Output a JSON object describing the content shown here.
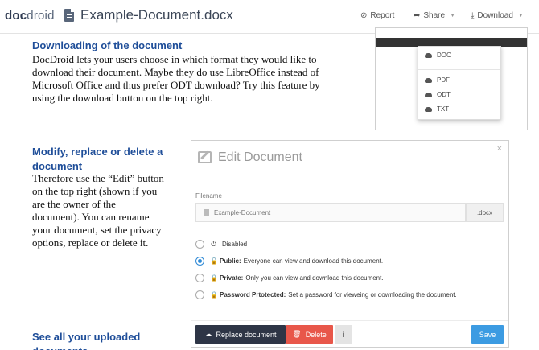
{
  "header": {
    "brand_bold": "doc",
    "brand_rest": "droid",
    "document_title": "Example-Document.docx",
    "report_label": "Report",
    "share_label": "Share",
    "download_label": "Download"
  },
  "content": {
    "section1_title": "Downloading of the document",
    "section1_lines": [
      "DocDroid lets your users choose in which format they would like to",
      "download their document. Maybe they do use LibreOffice instead of",
      "Microsoft Office and thus prefer ODT download? Try this feature by",
      "using the download button on the top right."
    ],
    "section2_title_lines": [
      "Modify, replace or delete a",
      "document"
    ],
    "section2_lines": [
      "Therefore use the “Edit” button",
      "on the top right (shown if you",
      "are the owner of the",
      "document). You can rename",
      "your document, set the privacy",
      "options, replace or delete it."
    ],
    "section3_title_lines": [
      "See all your uploaded",
      "documents"
    ]
  },
  "download_menu": {
    "items": [
      "DOC",
      "PDF",
      "ODT",
      "TXT"
    ]
  },
  "edit_modal": {
    "title": "Edit Document",
    "close_glyph": "×",
    "filename_label": "Filename",
    "filename_value": "Example-Document",
    "extension": ".docx",
    "privacy_options": [
      {
        "name": "",
        "description": "Disabled",
        "selected": false
      },
      {
        "name": "Public:",
        "description": "Everyone can view and download this document.",
        "selected": true
      },
      {
        "name": "Private:",
        "description": "Only you can view and download this document.",
        "selected": false
      },
      {
        "name": "Password Prtotected:",
        "description": "Set a password for vieweing or downloading the document.",
        "selected": false
      }
    ],
    "replace_label": "Replace document",
    "delete_label": "Delete",
    "info_label": "i",
    "save_label": "Save"
  },
  "colors": {
    "heading_blue": "#1f4e99",
    "save_blue": "#3c9be2",
    "delete_red": "#e8574a",
    "replace_dark": "#2e3546",
    "radio_selected": "#2f8ad6"
  }
}
